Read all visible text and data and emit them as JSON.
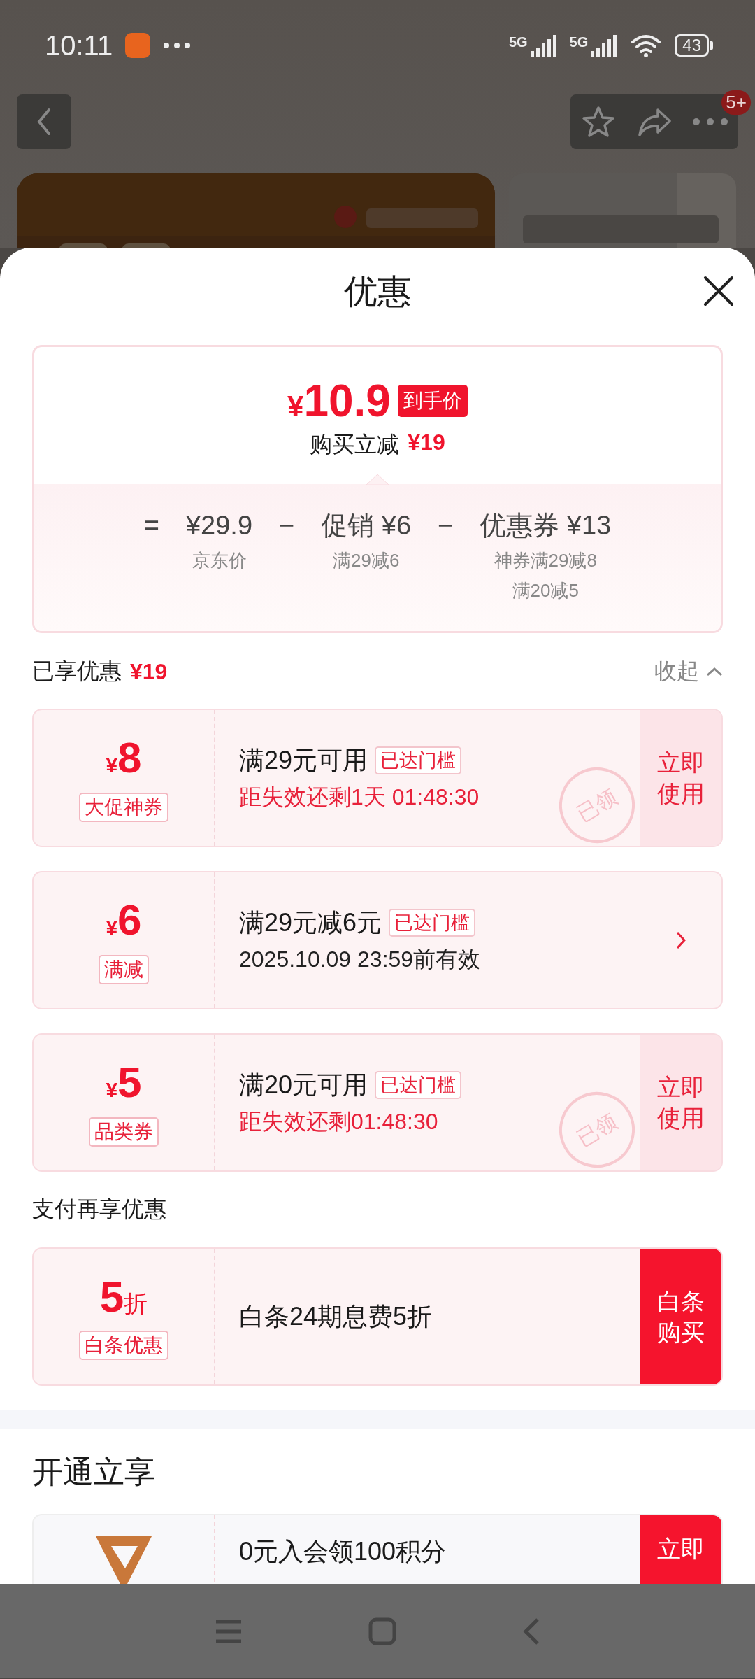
{
  "status_bar": {
    "time": "10:11",
    "network_1": "5G",
    "network_2": "5G",
    "battery": "43"
  },
  "header": {
    "badge": "5+"
  },
  "sheet": {
    "title": "优惠",
    "summary": {
      "currency": "¥",
      "price": "10.9",
      "price_tag": "到手价",
      "saving_label": "购买立减",
      "saving": "¥19",
      "breakdown": [
        {
          "kind": "sign",
          "text": "="
        },
        {
          "kind": "term",
          "text": "¥29.9",
          "notes": [
            "京东价"
          ]
        },
        {
          "kind": "sign",
          "text": "−"
        },
        {
          "kind": "term",
          "text": "促销 ¥6",
          "notes": [
            "满29减6"
          ]
        },
        {
          "kind": "sign",
          "text": "−"
        },
        {
          "kind": "term",
          "text": "优惠券 ¥13",
          "notes": [
            "神券满29减8",
            "满20减5"
          ]
        }
      ]
    },
    "enjoyed": {
      "label": "已享优惠",
      "amount": "¥19",
      "toggle": "收起",
      "expanded": true
    },
    "coupons": [
      {
        "symbol": "¥",
        "amount": "8",
        "tag": "大促神券",
        "title": "满29元可用",
        "badge": "已达门槛",
        "note": "距失效还剩1天 01:48:30",
        "urgent": true,
        "action": {
          "kind": "light",
          "label": "立即使用"
        },
        "stamp": "已领"
      },
      {
        "symbol": "¥",
        "amount": "6",
        "tag": "满减",
        "title": "满29元减6元",
        "badge": "已达门槛",
        "note": "2025.10.09 23:59前有效",
        "urgent": false,
        "action": {
          "kind": "chevron"
        }
      },
      {
        "symbol": "¥",
        "amount": "5",
        "tag": "品类券",
        "title": "满20元可用",
        "badge": "已达门槛",
        "note": "距失效还剩01:48:30",
        "urgent": true,
        "action": {
          "kind": "light",
          "label": "立即使用"
        },
        "stamp": "已领"
      }
    ],
    "payment_heading": "支付再享优惠",
    "payment_offers": [
      {
        "amount": "5",
        "unit": "折",
        "tag": "白条优惠",
        "title": "白条24期息费5折",
        "action": {
          "kind": "solid",
          "label": "白条购买"
        }
      }
    ],
    "membership_heading": "开通立享",
    "membership_offers": [
      {
        "title": "0元入会领100积分",
        "action": {
          "kind": "solid",
          "label": "立即"
        }
      }
    ]
  }
}
